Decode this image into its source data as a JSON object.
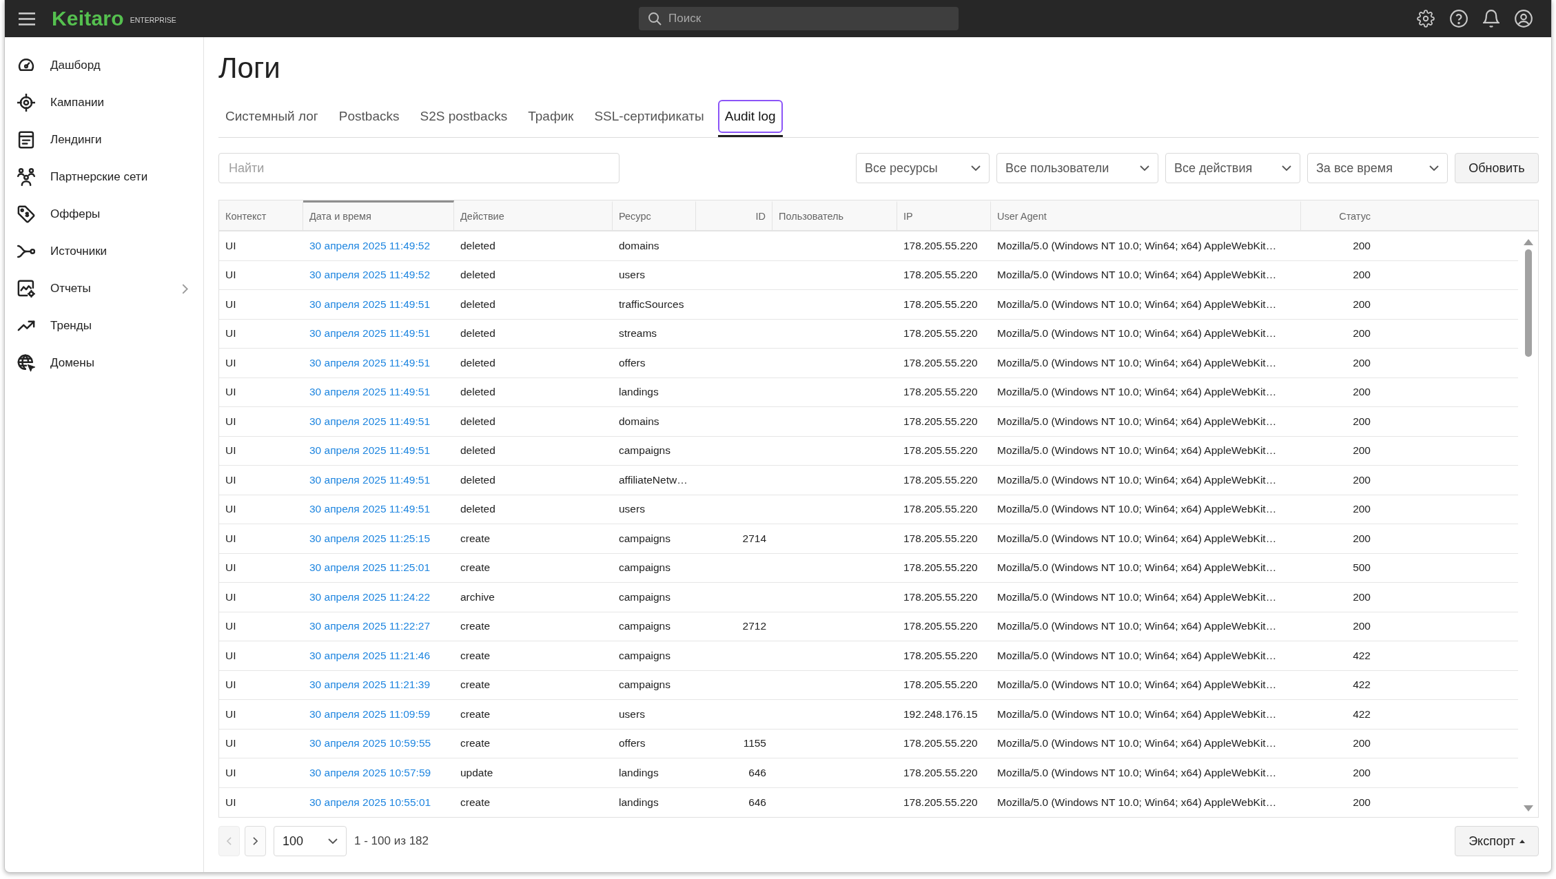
{
  "topbar": {
    "logo": "Keitaro",
    "edition": "ENTERPRISE",
    "search": {
      "placeholder": "Поиск"
    }
  },
  "sidebar": {
    "items": [
      {
        "label": "Дашборд",
        "has_submenu": false
      },
      {
        "label": "Кампании",
        "has_submenu": false
      },
      {
        "label": "Лендинги",
        "has_submenu": false
      },
      {
        "label": "Партнерские сети",
        "has_submenu": false
      },
      {
        "label": "Офферы",
        "has_submenu": false
      },
      {
        "label": "Источники",
        "has_submenu": false
      },
      {
        "label": "Отчеты",
        "has_submenu": true
      },
      {
        "label": "Тренды",
        "has_submenu": false
      },
      {
        "label": "Домены",
        "has_submenu": false
      }
    ]
  },
  "page": {
    "title": "Логи"
  },
  "tabs": [
    {
      "label": "Системный лог",
      "selected": false
    },
    {
      "label": "Postbacks",
      "selected": false
    },
    {
      "label": "S2S postbacks",
      "selected": false
    },
    {
      "label": "Трафик",
      "selected": false
    },
    {
      "label": "SSL-сертификаты",
      "selected": false
    },
    {
      "label": "Audit log",
      "selected": true
    }
  ],
  "filters": {
    "search": {
      "placeholder": "Найти"
    },
    "dropdowns": [
      {
        "value": "Все ресурсы"
      },
      {
        "value": "Все пользователи"
      },
      {
        "value": "Все действия"
      },
      {
        "value": "За все время"
      }
    ],
    "refresh_button": "Обновить"
  },
  "table": {
    "columns": [
      {
        "label": "Контекст",
        "sorted": false
      },
      {
        "label": "Дата и время",
        "sorted": true
      },
      {
        "label": "Действие",
        "sorted": false
      },
      {
        "label": "Ресурс",
        "sorted": false
      },
      {
        "label": "ID",
        "sorted": false
      },
      {
        "label": "Пользователь",
        "sorted": false
      },
      {
        "label": "IP",
        "sorted": false
      },
      {
        "label": "User Agent",
        "sorted": false
      },
      {
        "label": "Статус",
        "sorted": false
      }
    ],
    "rows": [
      {
        "context": "UI",
        "date_time": "30 апреля 2025 11:49:52",
        "action": "deleted",
        "resource": "domains",
        "ip": "178.205.55.220",
        "user_agent": "Mozilla/5.0 (Windows NT 10.0; Win64; x64) AppleWebKit…",
        "status": "200"
      },
      {
        "context": "UI",
        "date_time": "30 апреля 2025 11:49:52",
        "action": "deleted",
        "resource": "users",
        "ip": "178.205.55.220",
        "user_agent": "Mozilla/5.0 (Windows NT 10.0; Win64; x64) AppleWebKit…",
        "status": "200"
      },
      {
        "context": "UI",
        "date_time": "30 апреля 2025 11:49:51",
        "action": "deleted",
        "resource": "trafficSources",
        "ip": "178.205.55.220",
        "user_agent": "Mozilla/5.0 (Windows NT 10.0; Win64; x64) AppleWebKit…",
        "status": "200"
      },
      {
        "context": "UI",
        "date_time": "30 апреля 2025 11:49:51",
        "action": "deleted",
        "resource": "streams",
        "ip": "178.205.55.220",
        "user_agent": "Mozilla/5.0 (Windows NT 10.0; Win64; x64) AppleWebKit…",
        "status": "200"
      },
      {
        "context": "UI",
        "date_time": "30 апреля 2025 11:49:51",
        "action": "deleted",
        "resource": "offers",
        "ip": "178.205.55.220",
        "user_agent": "Mozilla/5.0 (Windows NT 10.0; Win64; x64) AppleWebKit…",
        "status": "200"
      },
      {
        "context": "UI",
        "date_time": "30 апреля 2025 11:49:51",
        "action": "deleted",
        "resource": "landings",
        "ip": "178.205.55.220",
        "user_agent": "Mozilla/5.0 (Windows NT 10.0; Win64; x64) AppleWebKit…",
        "status": "200"
      },
      {
        "context": "UI",
        "date_time": "30 апреля 2025 11:49:51",
        "action": "deleted",
        "resource": "domains",
        "ip": "178.205.55.220",
        "user_agent": "Mozilla/5.0 (Windows NT 10.0; Win64; x64) AppleWebKit…",
        "status": "200"
      },
      {
        "context": "UI",
        "date_time": "30 апреля 2025 11:49:51",
        "action": "deleted",
        "resource": "campaigns",
        "ip": "178.205.55.220",
        "user_agent": "Mozilla/5.0 (Windows NT 10.0; Win64; x64) AppleWebKit…",
        "status": "200"
      },
      {
        "context": "UI",
        "date_time": "30 апреля 2025 11:49:51",
        "action": "deleted",
        "resource": "affiliateNetw…",
        "ip": "178.205.55.220",
        "user_agent": "Mozilla/5.0 (Windows NT 10.0; Win64; x64) AppleWebKit…",
        "status": "200"
      },
      {
        "context": "UI",
        "date_time": "30 апреля 2025 11:49:51",
        "action": "deleted",
        "resource": "users",
        "ip": "178.205.55.220",
        "user_agent": "Mozilla/5.0 (Windows NT 10.0; Win64; x64) AppleWebKit…",
        "status": "200"
      },
      {
        "context": "UI",
        "date_time": "30 апреля 2025 11:25:15",
        "action": "create",
        "resource": "campaigns",
        "id": "2714",
        "ip": "178.205.55.220",
        "user_agent": "Mozilla/5.0 (Windows NT 10.0; Win64; x64) AppleWebKit…",
        "status": "200"
      },
      {
        "context": "UI",
        "date_time": "30 апреля 2025 11:25:01",
        "action": "create",
        "resource": "campaigns",
        "ip": "178.205.55.220",
        "user_agent": "Mozilla/5.0 (Windows NT 10.0; Win64; x64) AppleWebKit…",
        "status": "500"
      },
      {
        "context": "UI",
        "date_time": "30 апреля 2025 11:24:22",
        "action": "archive",
        "resource": "campaigns",
        "ip": "178.205.55.220",
        "user_agent": "Mozilla/5.0 (Windows NT 10.0; Win64; x64) AppleWebKit…",
        "status": "200"
      },
      {
        "context": "UI",
        "date_time": "30 апреля 2025 11:22:27",
        "action": "create",
        "resource": "campaigns",
        "id": "2712",
        "ip": "178.205.55.220",
        "user_agent": "Mozilla/5.0 (Windows NT 10.0; Win64; x64) AppleWebKit…",
        "status": "200"
      },
      {
        "context": "UI",
        "date_time": "30 апреля 2025 11:21:46",
        "action": "create",
        "resource": "campaigns",
        "ip": "178.205.55.220",
        "user_agent": "Mozilla/5.0 (Windows NT 10.0; Win64; x64) AppleWebKit…",
        "status": "422"
      },
      {
        "context": "UI",
        "date_time": "30 апреля 2025 11:21:39",
        "action": "create",
        "resource": "campaigns",
        "ip": "178.205.55.220",
        "user_agent": "Mozilla/5.0 (Windows NT 10.0; Win64; x64) AppleWebKit…",
        "status": "422"
      },
      {
        "context": "UI",
        "date_time": "30 апреля 2025 11:09:59",
        "action": "create",
        "resource": "users",
        "ip": "192.248.176.15",
        "user_agent": "Mozilla/5.0 (Windows NT 10.0; Win64; x64) AppleWebKit…",
        "status": "422"
      },
      {
        "context": "UI",
        "date_time": "30 апреля 2025 10:59:55",
        "action": "create",
        "resource": "offers",
        "id": "1155",
        "ip": "178.205.55.220",
        "user_agent": "Mozilla/5.0 (Windows NT 10.0; Win64; x64) AppleWebKit…",
        "status": "200"
      },
      {
        "context": "UI",
        "date_time": "30 апреля 2025 10:57:59",
        "action": "update",
        "resource": "landings",
        "id": "646",
        "ip": "178.205.55.220",
        "user_agent": "Mozilla/5.0 (Windows NT 10.0; Win64; x64) AppleWebKit…",
        "status": "200"
      },
      {
        "context": "UI",
        "date_time": "30 апреля 2025 10:55:01",
        "action": "create",
        "resource": "landings",
        "id": "646",
        "ip": "178.205.55.220",
        "user_agent": "Mozilla/5.0 (Windows NT 10.0; Win64; x64) AppleWebKit…",
        "status": "200"
      }
    ]
  },
  "pagination": {
    "prev": {
      "disabled": true
    },
    "next": {
      "disabled": false
    },
    "page_size": "100",
    "range": "1 - 100 из 182"
  },
  "export_button": "Экспорт"
}
